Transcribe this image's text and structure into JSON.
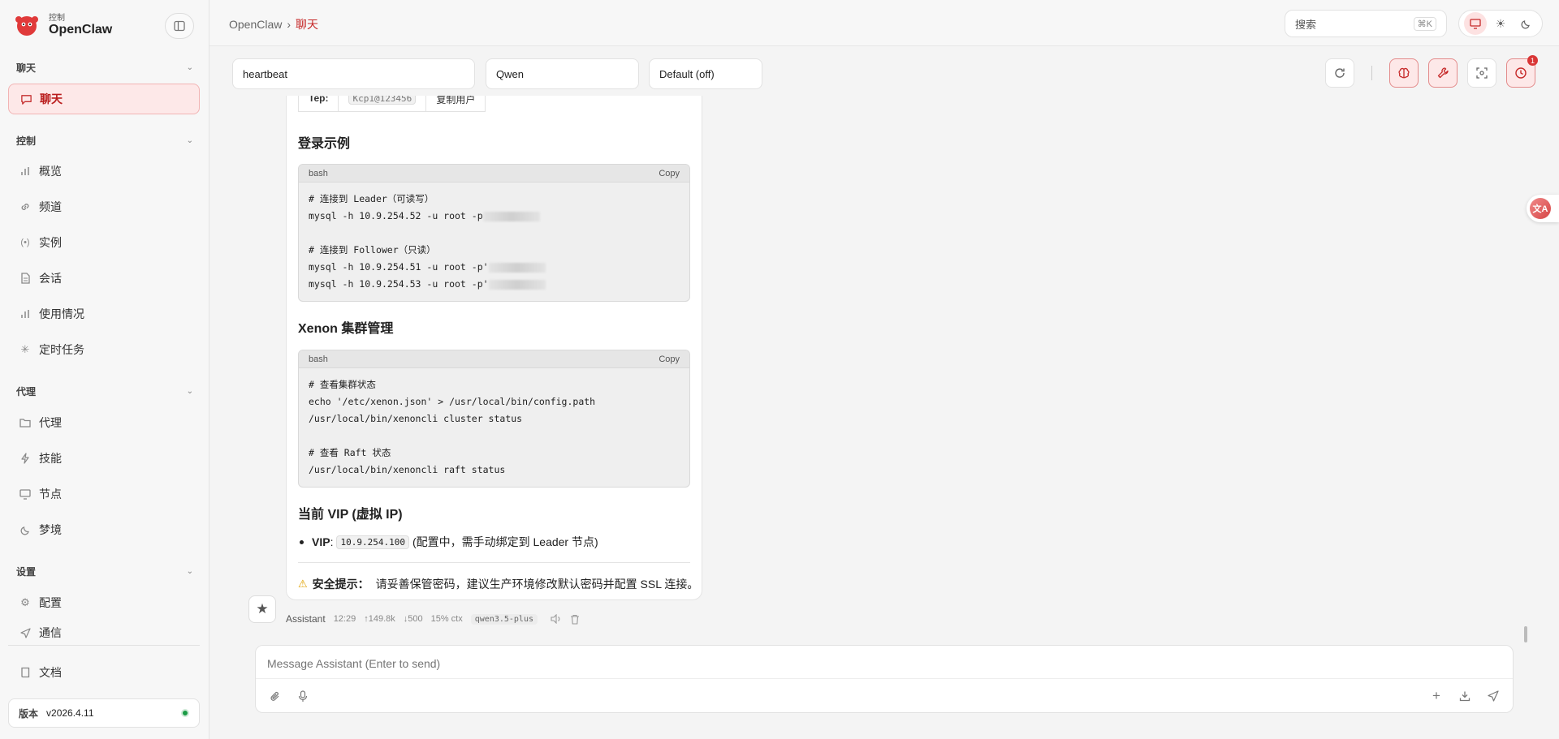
{
  "brand": {
    "small": "控制",
    "name": "OpenClaw"
  },
  "sidebar": {
    "sections": [
      {
        "title": "聊天",
        "items": [
          {
            "label": "聊天",
            "icon": "message-icon"
          }
        ]
      },
      {
        "title": "控制",
        "items": [
          {
            "label": "概览",
            "icon": "bar-chart-icon"
          },
          {
            "label": "频道",
            "icon": "link-icon"
          },
          {
            "label": "实例",
            "icon": "broadcast-icon"
          },
          {
            "label": "会话",
            "icon": "document-icon"
          },
          {
            "label": "使用情况",
            "icon": "bar-chart-icon"
          },
          {
            "label": "定时任务",
            "icon": "loader-icon"
          }
        ]
      },
      {
        "title": "代理",
        "items": [
          {
            "label": "代理",
            "icon": "folder-icon"
          },
          {
            "label": "技能",
            "icon": "zap-icon"
          },
          {
            "label": "节点",
            "icon": "monitor-icon"
          },
          {
            "label": "梦境",
            "icon": "moon-icon"
          }
        ]
      },
      {
        "title": "设置",
        "items": [
          {
            "label": "配置",
            "icon": "gear-icon"
          },
          {
            "label": "通信",
            "icon": "send-icon"
          }
        ]
      }
    ],
    "docs_label": "文档",
    "version_label": "版本",
    "version_value": "v2026.4.11"
  },
  "topbar": {
    "breadcrumb_root": "OpenClaw",
    "breadcrumb_sep": "›",
    "breadcrumb_current": "聊天",
    "search_placeholder": "搜索",
    "search_shortcut": "⌘K"
  },
  "toolbar": {
    "session_value": "heartbeat",
    "model_value": "Qwen",
    "thinking_value": "Default (off)",
    "cron_badge": "1"
  },
  "message": {
    "table_fragment": [
      "Tep:",
      "Kcp1@123456",
      "复制用户"
    ],
    "sections": [
      {
        "heading": "登录示例",
        "code_lang": "bash",
        "copy_label": "Copy",
        "lines": [
          "# 连接到 Leader（可读写）",
          "mysql -h 10.9.254.52 -u root -p",
          "",
          "# 连接到 Follower（只读）",
          "mysql -h 10.9.254.51 -u root -p'",
          "mysql -h 10.9.254.53 -u root -p'"
        ]
      },
      {
        "heading": "Xenon 集群管理",
        "code_lang": "bash",
        "copy_label": "Copy",
        "lines": [
          "# 查看集群状态",
          "echo '/etc/xenon.json' > /usr/local/bin/config.path",
          "/usr/local/bin/xenoncli cluster status",
          "",
          "# 查看 Raft 状态",
          "/usr/local/bin/xenoncli raft status"
        ]
      }
    ],
    "vip_heading": "当前 VIP (虚拟 IP)",
    "vip_label": "VIP",
    "vip_colon": ":",
    "vip_value": "10.9.254.100",
    "vip_note": "(配置中，需手动绑定到 Leader 节点)",
    "warning_title": "安全提示：",
    "warning_text": "请妥善保管密码，建议生产环境修改默认密码并配置 SSL 连接。"
  },
  "meta": {
    "sender": "Assistant",
    "time": "12:29",
    "tokens_in": "↑149.8k",
    "tokens_out": "↓500",
    "ctx": "15% ctx",
    "model": "qwen3.5-plus"
  },
  "composer": {
    "placeholder": "Message Assistant (Enter to send)"
  },
  "colors": {
    "accent": "#c62828",
    "accent_bg": "#fde8e8",
    "status_online": "#1a9b45"
  }
}
